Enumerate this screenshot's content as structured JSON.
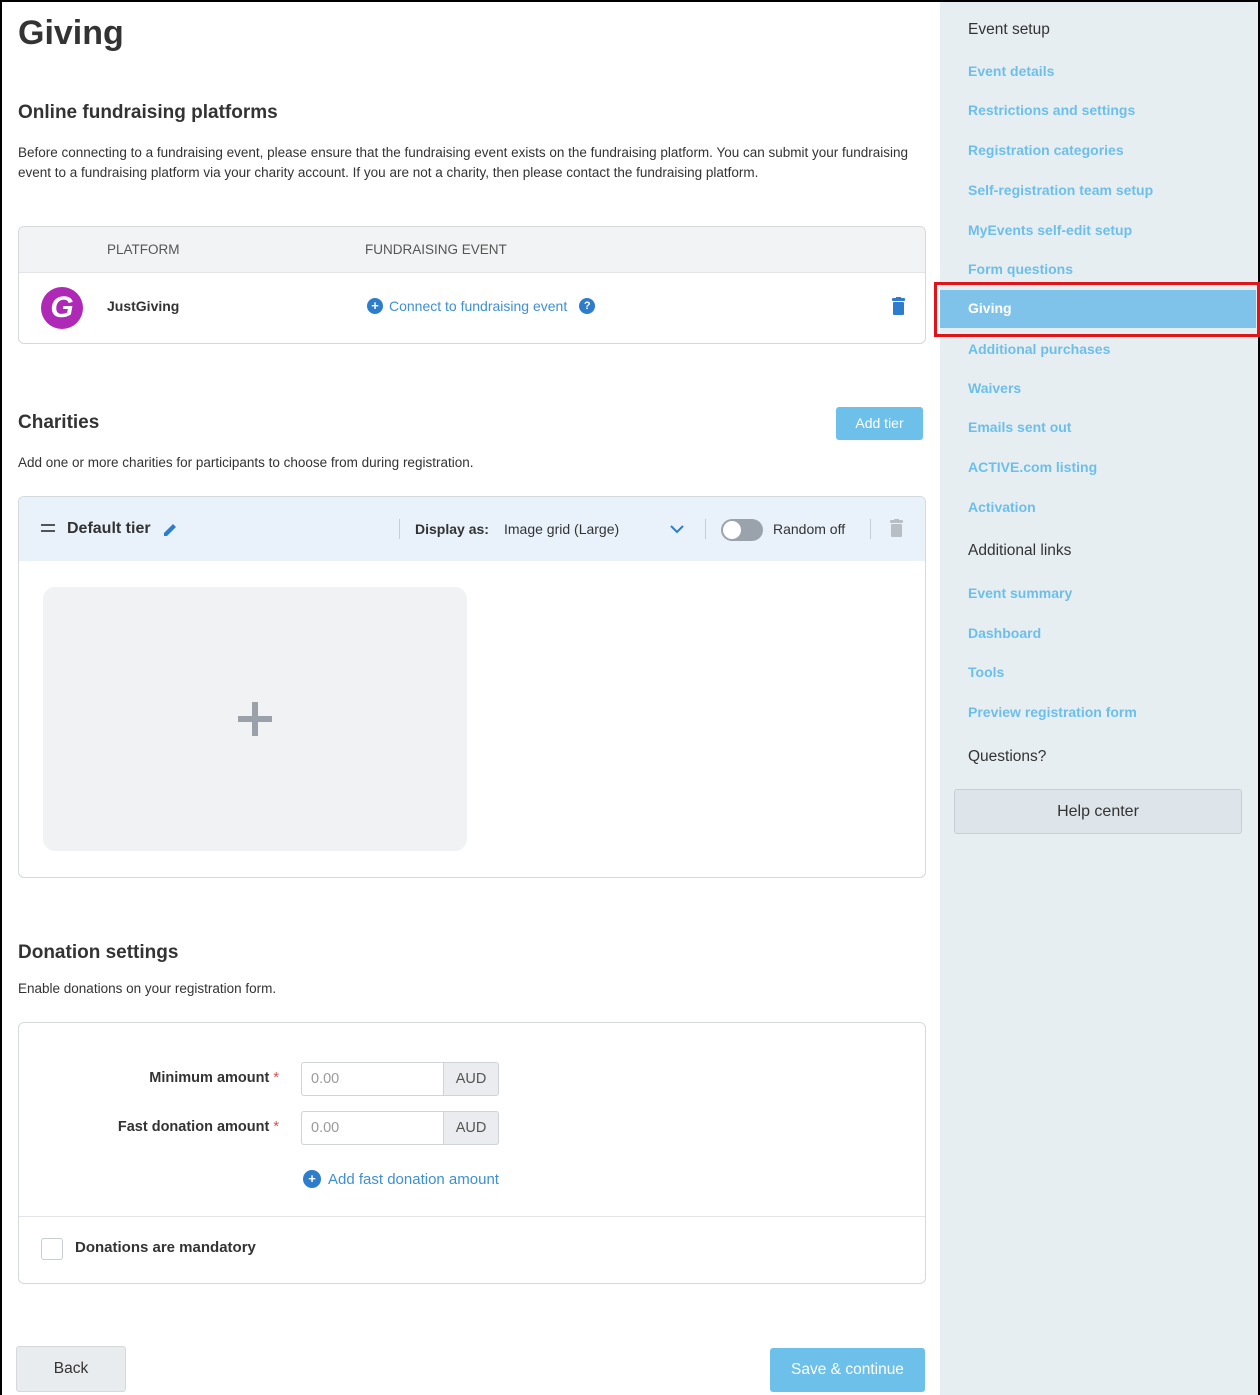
{
  "page": {
    "title": "Giving"
  },
  "platforms": {
    "title": "Online fundraising platforms",
    "description": "Before connecting to a fundraising event, please ensure that the fundraising event exists on the fundraising platform. You can submit your fundraising event to a fundraising platform via your charity account. If you are not a charity, then please contact the fundraising platform.",
    "columns": [
      "PLATFORM",
      "FUNDRAISING EVENT"
    ],
    "rows": [
      {
        "name": "JustGiving",
        "logo_letter": "G",
        "logo_color": "#ad29b6",
        "action": "Connect to fundraising event"
      }
    ]
  },
  "charities": {
    "title": "Charities",
    "description": "Add one or more charities for participants to choose from during registration.",
    "add_tier_label": "Add tier",
    "tier": {
      "name": "Default tier",
      "display_label": "Display as:",
      "display_value": "Image grid (Large)",
      "random_label": "Random off",
      "random_on": false
    }
  },
  "donation": {
    "title": "Donation settings",
    "description": "Enable donations on your registration form.",
    "min_label": "Minimum amount",
    "min_placeholder": "0.00",
    "fast_label": "Fast donation amount",
    "fast_placeholder": "0.00",
    "currency": "AUD",
    "required_mark": "*",
    "add_fast_label": "Add fast donation amount",
    "mandatory_label": "Donations are mandatory",
    "mandatory_checked": false
  },
  "footer": {
    "back_label": "Back",
    "save_label": "Save & continue"
  },
  "sidebar": {
    "event_setup_heading": "Event setup",
    "items": [
      "Event details",
      "Restrictions and settings",
      "Registration categories",
      "Self-registration team setup",
      "MyEvents self-edit setup",
      "Form questions",
      "Giving",
      "Additional purchases",
      "Waivers",
      "Emails sent out",
      "ACTIVE.com listing",
      "Activation"
    ],
    "active_item": "Giving",
    "additional_heading": "Additional links",
    "additional_items": [
      "Event summary",
      "Dashboard",
      "Tools",
      "Preview registration form"
    ],
    "questions_heading": "Questions?",
    "help_label": "Help center"
  },
  "colors": {
    "accent": "#6cc0ea",
    "link": "#3d8fd6",
    "sidebar_bg": "#e7eef2",
    "highlight": "#e0151a"
  }
}
